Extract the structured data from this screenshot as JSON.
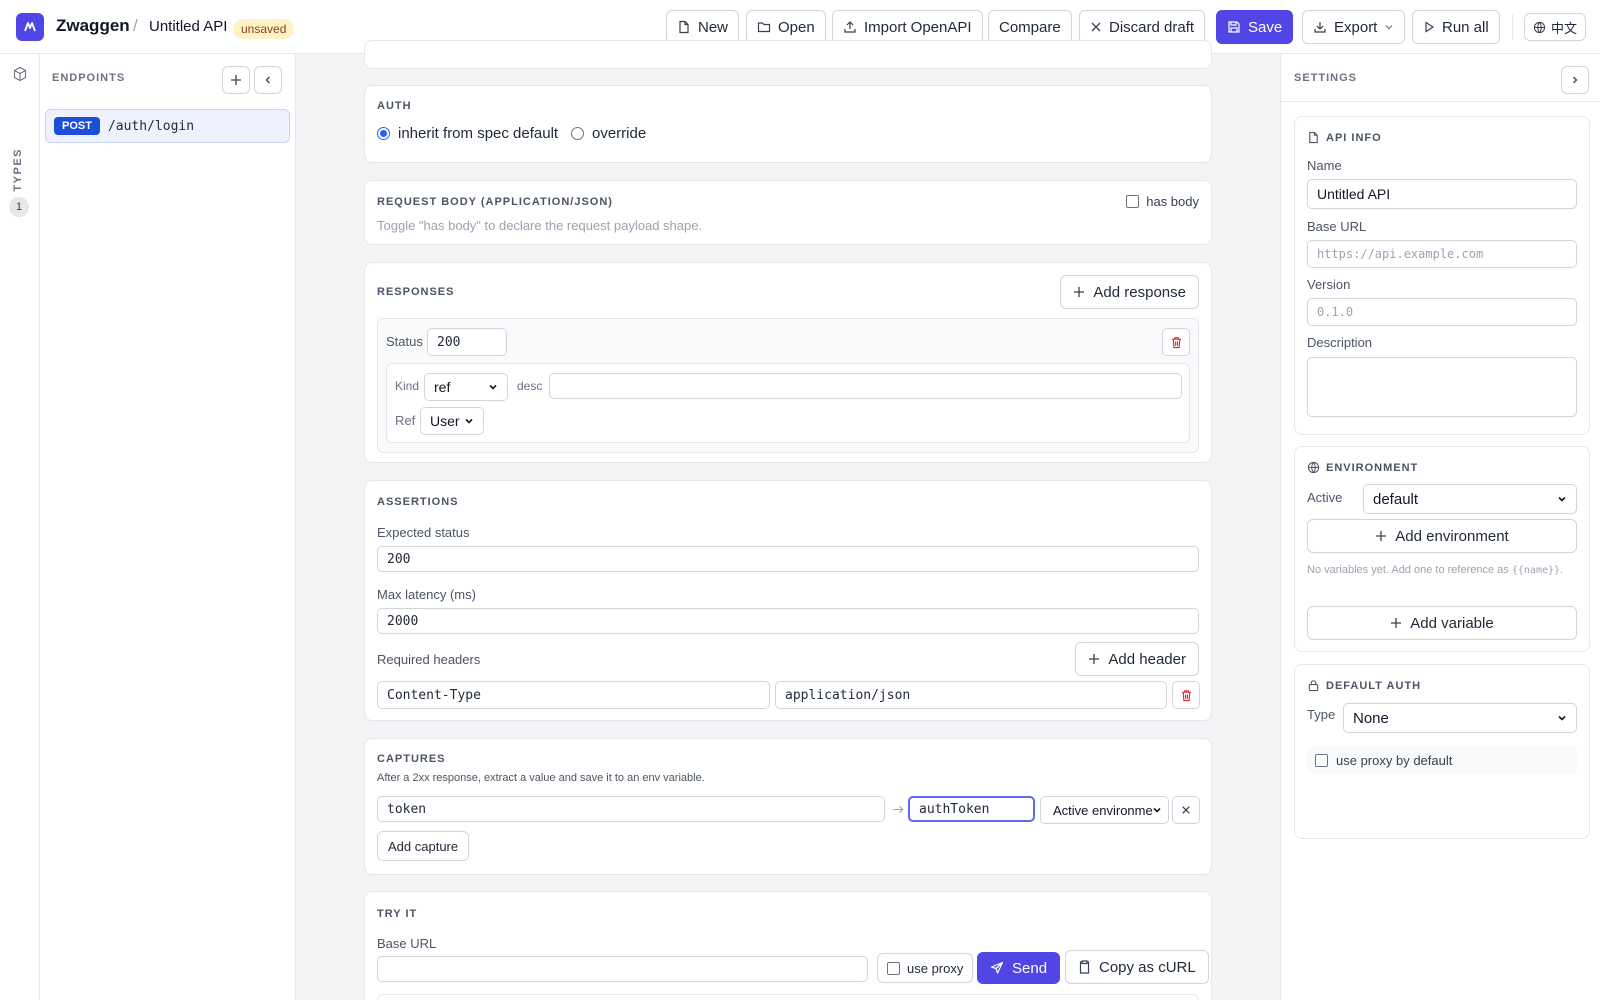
{
  "app": {
    "brand": "Zwaggen",
    "separator": "/",
    "api_name": "Untitled API",
    "status_badge": "unsaved",
    "accent": "#4f46e5"
  },
  "toolbar": {
    "new": "New",
    "open": "Open",
    "import_openapi": "Import OpenAPI",
    "compare": "Compare",
    "discard_draft": "Discard draft",
    "save": "Save",
    "export": "Export",
    "run_all": "Run all",
    "language": "中文"
  },
  "rail": {
    "types_label": "TYPES",
    "types_count": "1"
  },
  "endpoints": {
    "title": "ENDPOINTS",
    "items": [
      {
        "method": "POST",
        "path": "/auth/login",
        "method_color": "#1d4ed8"
      }
    ]
  },
  "auth": {
    "title": "AUTH",
    "options": [
      "inherit from spec default",
      "override"
    ],
    "selected": "inherit from spec default"
  },
  "request_body": {
    "title": "REQUEST BODY (APPLICATION/JSON)",
    "has_body_label": "has body",
    "hint": "Toggle \"has body\" to declare the request payload shape."
  },
  "responses": {
    "title": "RESPONSES",
    "add_label": "Add response",
    "items": [
      {
        "status_label": "Status",
        "status": "200",
        "kind_label": "Kind",
        "kind": "ref",
        "desc_label": "desc",
        "desc": "",
        "ref_label": "Ref",
        "ref": "User"
      }
    ]
  },
  "assertions": {
    "title": "ASSERTIONS",
    "expected_status_label": "Expected status",
    "expected_status": "200",
    "max_latency_label": "Max latency (ms)",
    "max_latency": "2000",
    "required_headers_label": "Required headers",
    "add_header_label": "Add header",
    "headers": [
      {
        "name": "Content-Type",
        "value": "application/json"
      }
    ]
  },
  "captures": {
    "title": "CAPTURES",
    "hint": "After a 2xx response, extract a value and save it to an env variable.",
    "items": [
      {
        "path": "token",
        "variable": "authToken",
        "target": "Active environment"
      }
    ],
    "add_label": "Add capture"
  },
  "try_it": {
    "title": "TRY IT",
    "base_url_label": "Base URL",
    "base_url": "",
    "use_proxy_label": "use proxy",
    "send_label": "Send",
    "copy_curl_label": "Copy as cURL"
  },
  "settings": {
    "title": "SETTINGS",
    "api_info": {
      "title": "API INFO",
      "name_label": "Name",
      "name": "Untitled API",
      "base_url_label": "Base URL",
      "base_url_placeholder": "https://api.example.com",
      "version_label": "Version",
      "version_placeholder": "0.1.0",
      "description_label": "Description",
      "description": ""
    },
    "environment": {
      "title": "ENVIRONMENT",
      "active_label": "Active",
      "active": "default",
      "add_environment_label": "Add environment",
      "hint_prefix": "No variables yet. Add one to reference as",
      "hint_token": "{{name}}",
      "hint_suffix": ".",
      "add_variable_label": "Add variable"
    },
    "default_auth": {
      "title": "DEFAULT AUTH",
      "type_label": "Type",
      "type": "None",
      "proxy_label": "use proxy by default"
    }
  }
}
